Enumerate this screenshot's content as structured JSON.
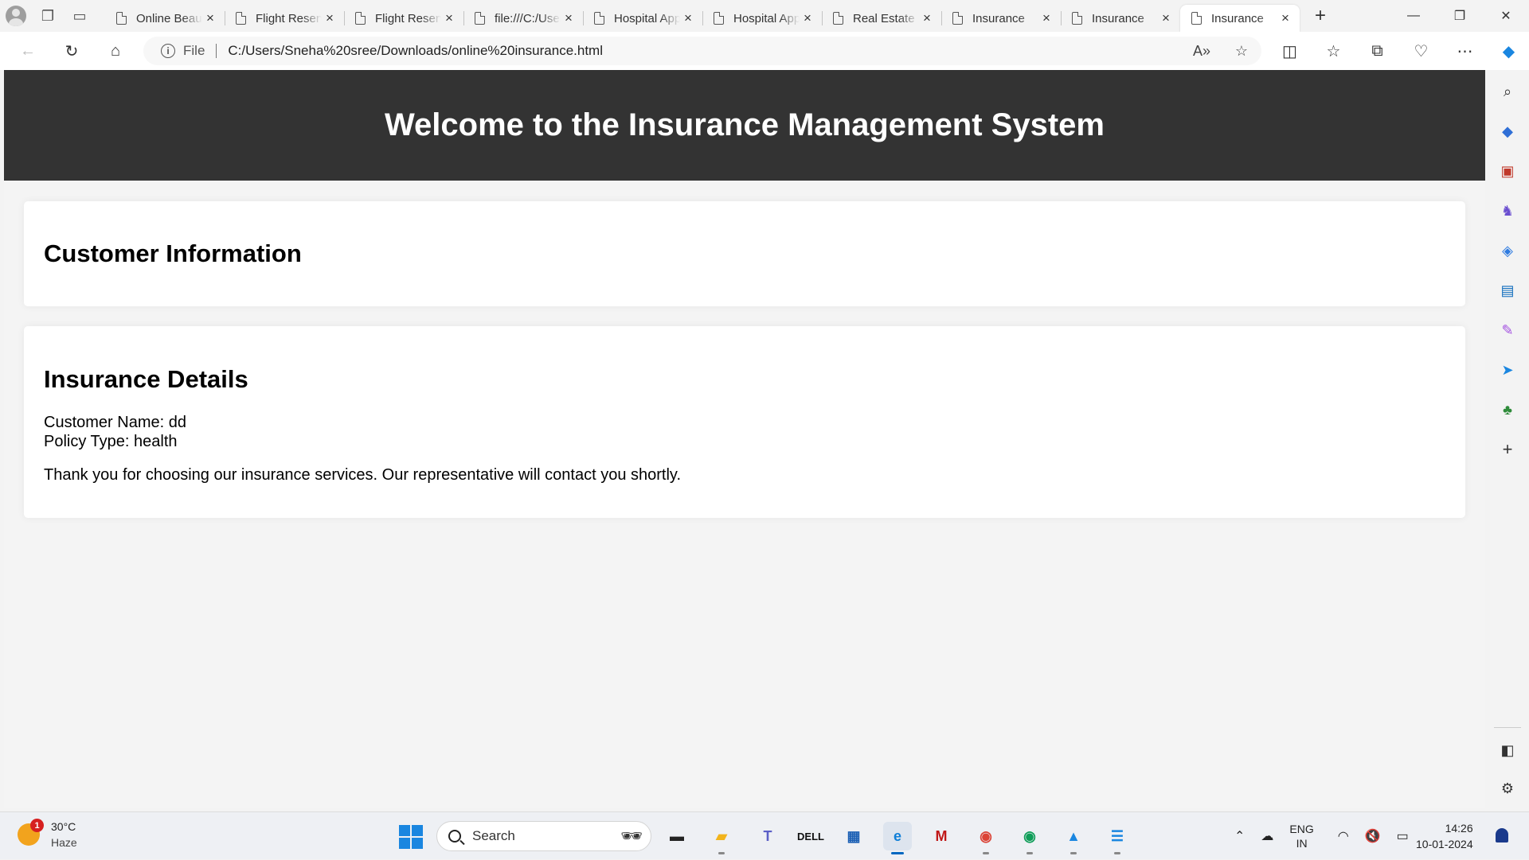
{
  "browser": {
    "tabs": [
      {
        "title": "Online Beauty"
      },
      {
        "title": "Flight Reservation"
      },
      {
        "title": "Flight Reservation"
      },
      {
        "title": "file:///C:/Users"
      },
      {
        "title": "Hospital Appointment"
      },
      {
        "title": "Hospital Appointment"
      },
      {
        "title": "Real Estate"
      },
      {
        "title": "Insurance"
      },
      {
        "title": "Insurance"
      },
      {
        "title": "Insurance"
      }
    ],
    "active_tab_index": 9,
    "close_glyph": "×",
    "new_tab_glyph": "+",
    "address": {
      "scheme_label": "File",
      "url": "C:/Users/Sneha%20sree/Downloads/online%20insurance.html"
    }
  },
  "page": {
    "header_title": "Welcome to the Insurance Management System",
    "customer_section": {
      "heading": "Customer Information"
    },
    "insurance_section": {
      "heading": "Insurance Details",
      "customer_name_line": "Customer Name: dd",
      "policy_type_line": "Policy Type: health",
      "thanks_message": "Thank you for choosing our insurance services. Our representative will contact you shortly."
    }
  },
  "taskbar": {
    "weather": {
      "badge": "1",
      "temperature": "30°C",
      "condition": "Haze"
    },
    "search_placeholder": "Search",
    "language": {
      "line1": "ENG",
      "line2": "IN"
    },
    "clock": {
      "time": "14:26",
      "date": "10-01-2024"
    }
  },
  "colors": {
    "page_header_bg": "#333333",
    "page_bg": "#f4f4f4",
    "card_bg": "#ffffff",
    "taskbar_bg": "#eef0f4",
    "accent": "#0067c0"
  },
  "icons": {
    "sidebar": [
      "search-icon",
      "tag-icon",
      "briefcase-icon",
      "chess-icon",
      "m365-icon",
      "outlook-icon",
      "designer-icon",
      "send-icon",
      "tree-icon",
      "add-icon",
      "panel-icon",
      "settings-icon"
    ]
  }
}
